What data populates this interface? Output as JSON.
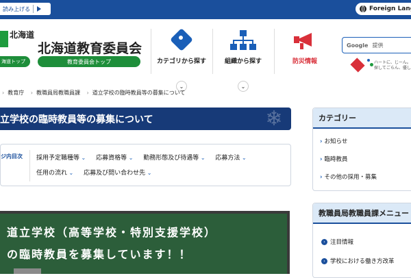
{
  "topbar": {
    "read_aloud": "読み上げる",
    "foreign_language": "Foreign Lang"
  },
  "header": {
    "hokkaido_name": "北海道",
    "hokkaido_top": "海道トップ",
    "board_title": "北海道教育委員会",
    "board_top": "教育委員会トップ",
    "nav": [
      {
        "label": "カテゴリから探す",
        "icon": "tag-icon"
      },
      {
        "label": "組織から探す",
        "icon": "org-chart-icon"
      },
      {
        "label": "防災情報",
        "icon": "megaphone-icon"
      }
    ],
    "search": {
      "brand": "Google",
      "placeholder": "提供"
    },
    "mascot_text": "ハートに、じーん。 探してごらん、優し"
  },
  "breadcrumb": [
    "教育庁",
    "教職員局教職員課",
    "道立学校の臨時教員等の募集について"
  ],
  "page_title": "立学校の臨時教員等の募集について",
  "toc": {
    "label": "ジ内目次",
    "row1": [
      "採用予定職種等",
      "応募資格等",
      "勤務形態及び待遇等",
      "応募方法"
    ],
    "row2": [
      "任用の流れ",
      "応募及び問い合わせ先"
    ]
  },
  "banner": {
    "line1": "道立学校（高等学校・特別支援学校）",
    "line2": "の臨時教員を募集しています！！"
  },
  "sidebar": {
    "category_title": "カテゴリー",
    "category_items": [
      "お知らせ",
      "臨時教員",
      "その他の採用・募集"
    ],
    "menu_title": "教職員局教職員課メニュー",
    "menu_items": [
      "注目情報",
      "学校における働き方改革"
    ]
  },
  "colors": {
    "brand_blue": "#1a4f9c",
    "title_navy": "#173a78",
    "green": "#1e8e3a",
    "alert_red": "#d9303a",
    "chalkboard": "#2c5e3a"
  }
}
